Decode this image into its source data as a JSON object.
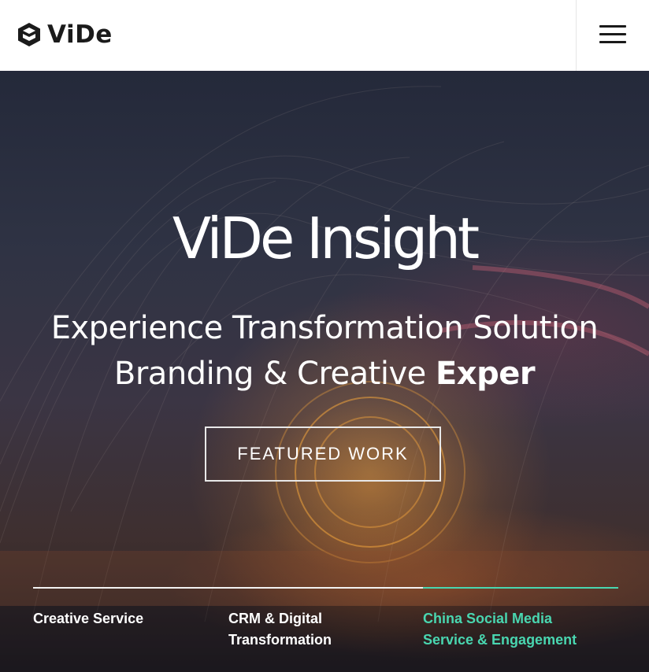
{
  "header": {
    "brand": "ViDe",
    "menu_icon": "hamburger-menu-icon",
    "logo_icon": "hexagon-logo-icon"
  },
  "hero": {
    "title": "ViDe Insight",
    "subtitle_line1": "Experience Transformation Solution",
    "subtitle_line2_plain": "Branding & Creative ",
    "subtitle_line2_strong": "Exper",
    "cta_label": "FEATURED WORK"
  },
  "tabs": [
    {
      "label_line1": "Creative Service",
      "label_line2": "",
      "active": false
    },
    {
      "label_line1": "CRM & Digital",
      "label_line2": "Transformation",
      "active": false
    },
    {
      "label_line1": "China Social Media",
      "label_line2": "Service & Engagement",
      "active": true
    }
  ],
  "colors": {
    "accent": "#49d6b0",
    "header_bg": "#ffffff",
    "brand_text": "#1b1b1b",
    "hero_text": "#ffffff"
  }
}
